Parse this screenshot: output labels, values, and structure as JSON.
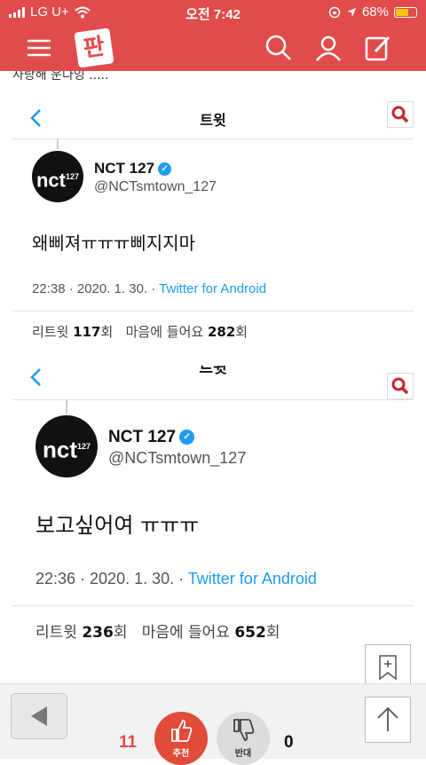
{
  "status_bar": {
    "carrier": "LG U+",
    "time": "오전 7:42",
    "battery": "68%",
    "battery_level": 0.68
  },
  "app": {
    "logo_text": "판"
  },
  "post": {
    "cut_text": "사랑해 운다잉 ....."
  },
  "tweets": [
    {
      "header_title": "트윗",
      "avatar_text": "nct",
      "avatar_sup": "127",
      "name": "NCT 127",
      "handle": "@NCTsmtown_127",
      "text": "왜삐져ㅠㅠㅠ삐지지마",
      "time": "22:38 · 2020. 1. 30. · ",
      "source": "Twitter for Android",
      "retweet_label": "리트윗 ",
      "retweet_count": "117",
      "retweet_unit": "회",
      "like_label": "마음에 들어요 ",
      "like_count": "282",
      "like_unit": "회"
    },
    {
      "header_title": "트윗",
      "avatar_text": "nct",
      "avatar_sup": "127",
      "name": "NCT 127",
      "handle": "@NCTsmtown_127",
      "text": "보고싶어여 ㅠㅠㅠ",
      "time": "22:36 · 2020. 1. 30. · ",
      "source": "Twitter for Android",
      "retweet_label": "리트윗 ",
      "retweet_count": "236",
      "retweet_unit": "회",
      "like_label": "마음에 들어요 ",
      "like_count": "652",
      "like_unit": "회"
    }
  ],
  "votes": {
    "up_count": "11",
    "up_label": "추천",
    "down_count": "0",
    "down_label": "반대"
  },
  "colors": {
    "brand": "#e24b4b",
    "twitter_blue": "#1d9bf0"
  }
}
